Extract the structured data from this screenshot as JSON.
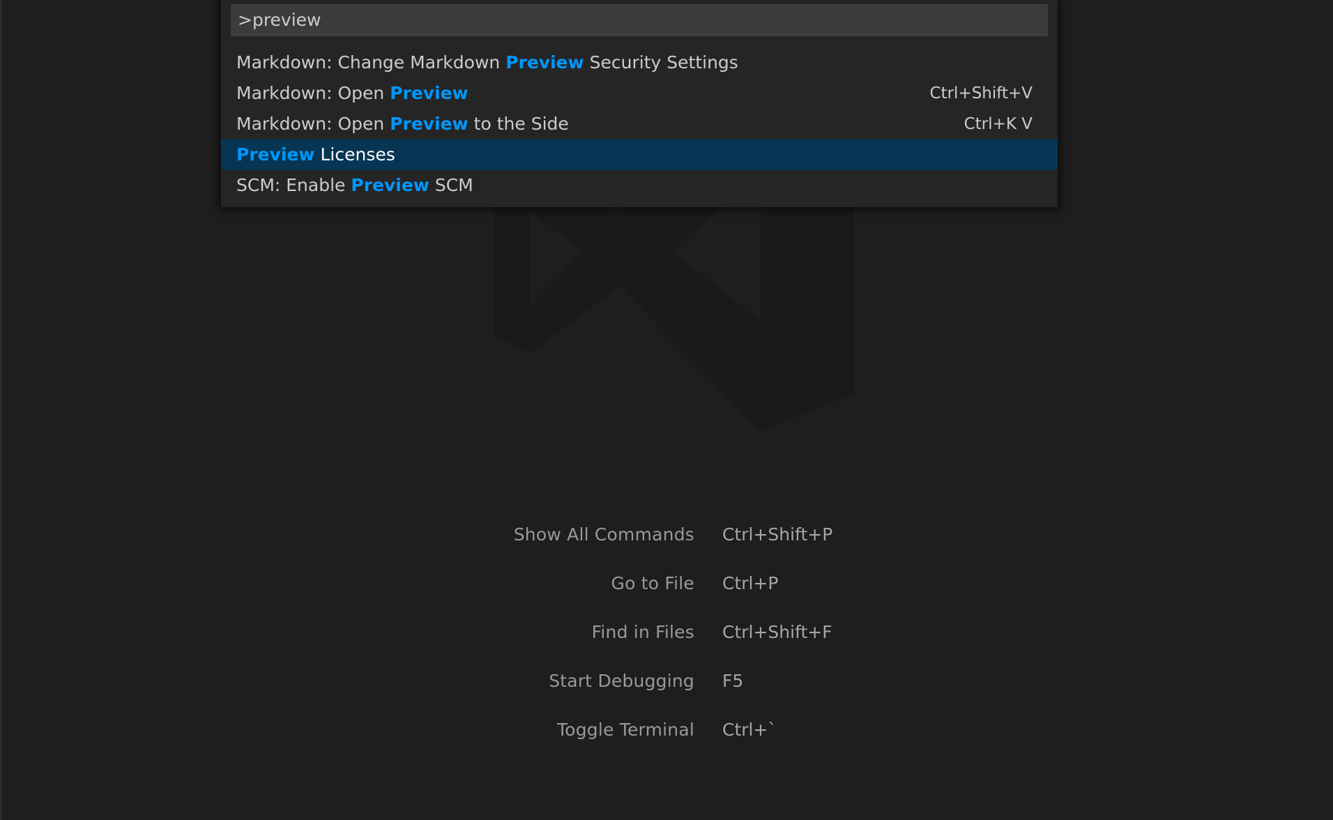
{
  "quick_open": {
    "input_value": ">preview",
    "items": [
      {
        "before": "Markdown: Change Markdown ",
        "highlight": "Preview",
        "after": " Security Settings",
        "keybinding": "",
        "selected": false
      },
      {
        "before": "Markdown: Open ",
        "highlight": "Preview",
        "after": "",
        "keybinding": "Ctrl+Shift+V",
        "selected": false
      },
      {
        "before": "Markdown: Open ",
        "highlight": "Preview",
        "after": " to the Side",
        "keybinding": "Ctrl+K V",
        "selected": false
      },
      {
        "before": "",
        "highlight": "Preview",
        "after": " Licenses",
        "keybinding": "",
        "selected": true
      },
      {
        "before": "SCM: Enable ",
        "highlight": "Preview",
        "after": " SCM",
        "keybinding": "",
        "selected": false
      }
    ]
  },
  "watermark": {
    "icon": "vscode-logo-watermark"
  },
  "shortcuts": [
    {
      "label": "Show All Commands",
      "key": "Ctrl+Shift+P"
    },
    {
      "label": "Go to File",
      "key": "Ctrl+P"
    },
    {
      "label": "Find in Files",
      "key": "Ctrl+Shift+F"
    },
    {
      "label": "Start Debugging",
      "key": "F5"
    },
    {
      "label": "Toggle Terminal",
      "key": "Ctrl+`"
    }
  ],
  "colors": {
    "background": "#1e1e1e",
    "widget": "#252526",
    "input": "#3c3c3c",
    "selection": "#073655",
    "highlight": "#0097fb"
  }
}
